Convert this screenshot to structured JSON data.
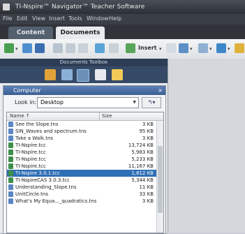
{
  "window": {
    "title": "TI-Nspire™ Navigator™ Teacher Software"
  },
  "menubar": {
    "items": [
      "File",
      "Edit",
      "View",
      "Insert",
      "Tools",
      "Window",
      "Help"
    ]
  },
  "tabs": {
    "content": "Content",
    "documents": "Documents"
  },
  "toolbar": {
    "insert_label": "Insert"
  },
  "toolbox": {
    "title": "Documents Toolbox"
  },
  "explorer": {
    "title": "Computer",
    "close": "×",
    "look_in_label": "Look in:",
    "look_in_value": "Desktop",
    "columns": {
      "name": "Name ↑",
      "size": "Size"
    },
    "rows": [
      {
        "name": "See the Slope.tns",
        "size": "3 KB",
        "type": "tns"
      },
      {
        "name": "SIN_Waves and spectrum.tns",
        "size": "95 KB",
        "type": "tns"
      },
      {
        "name": "Take a Walk.tns",
        "size": "3 KB",
        "type": "tns"
      },
      {
        "name": "TI-Nspire.tcc",
        "size": "13,724 KB",
        "type": "tcc"
      },
      {
        "name": "TI-Nspire.tcc",
        "size": "5,983 KB",
        "type": "tcc"
      },
      {
        "name": "TI-Nspire.tcc",
        "size": "5,233 KB",
        "type": "tcc"
      },
      {
        "name": "TI-Nspire.tcc",
        "size": "11,167 KB",
        "type": "tcc"
      },
      {
        "name": "TI-Nspire 3.0.1.tcc",
        "size": "1,812 KB",
        "type": "tcc",
        "selected": true
      },
      {
        "name": "TI-NspireCAS 3.0.3.tcc",
        "size": "5,344 KB",
        "type": "tcc"
      },
      {
        "name": "Understanding_Slope.tns",
        "size": "11 KB",
        "type": "tns"
      },
      {
        "name": "UnitCircle.tns",
        "size": "33 KB",
        "type": "tns"
      },
      {
        "name": "What's My Equa..._quadratics.tns",
        "size": "3 KB",
        "type": "tns"
      }
    ]
  },
  "colors": {
    "selection": "#2f6fb6",
    "panel_header": "#3c5e93",
    "toolbox_bg": "#364a67",
    "tns_icon": "#5b86c4",
    "tcc_icon": "#3d8f4a"
  }
}
